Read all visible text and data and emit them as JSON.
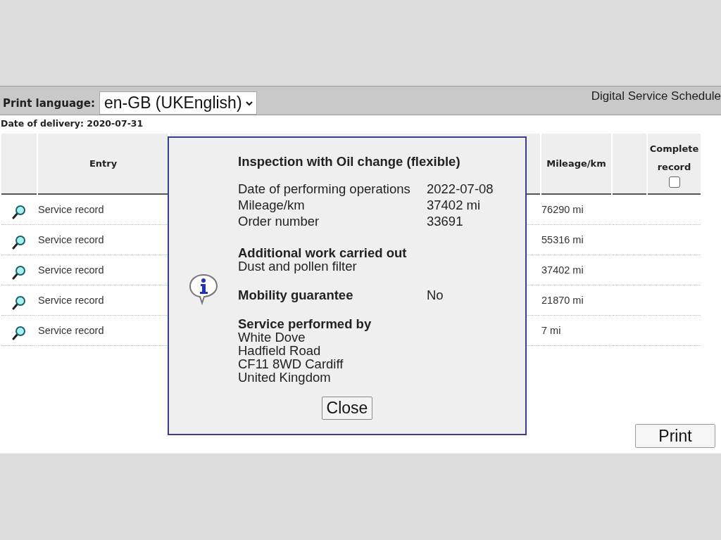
{
  "toolbar": {
    "print_language_label": "Print language:",
    "language_select": "en-GB (UKEnglish)",
    "title": "Digital Service Schedule"
  },
  "delivery_date": "Date of delivery: 2020-07-31",
  "table": {
    "columns": {
      "entry": "Entry",
      "mileage": "Mileage/km",
      "complete": "Complete record"
    },
    "complete_checked": false,
    "rows": [
      {
        "entry": "Service record",
        "mileage": "76290 mi"
      },
      {
        "entry": "Service record",
        "mileage": "55316 mi"
      },
      {
        "entry": "Service record",
        "mileage": "37402 mi"
      },
      {
        "entry": "Service record",
        "mileage": "21870 mi"
      },
      {
        "entry": "Service record",
        "mileage": "7 mi"
      }
    ]
  },
  "dialog": {
    "title": "Inspection with Oil change (flexible)",
    "fields": [
      {
        "label": "Date of performing operations",
        "value": "2022-07-08"
      },
      {
        "label": "Mileage/km",
        "value": "37402 mi"
      },
      {
        "label": "Order number",
        "value": "33691"
      }
    ],
    "additional_work": {
      "heading": "Additional work carried out",
      "text": "Dust and pollen filter"
    },
    "mobility": {
      "label": "Mobility guarantee",
      "value": "No"
    },
    "service_by": {
      "heading": "Service performed by",
      "lines": [
        "White Dove",
        "Hadfield Road",
        "CF11 8WD Cardiff",
        "United Kingdom"
      ]
    },
    "close_button": "Close"
  },
  "print_button": "Print"
}
